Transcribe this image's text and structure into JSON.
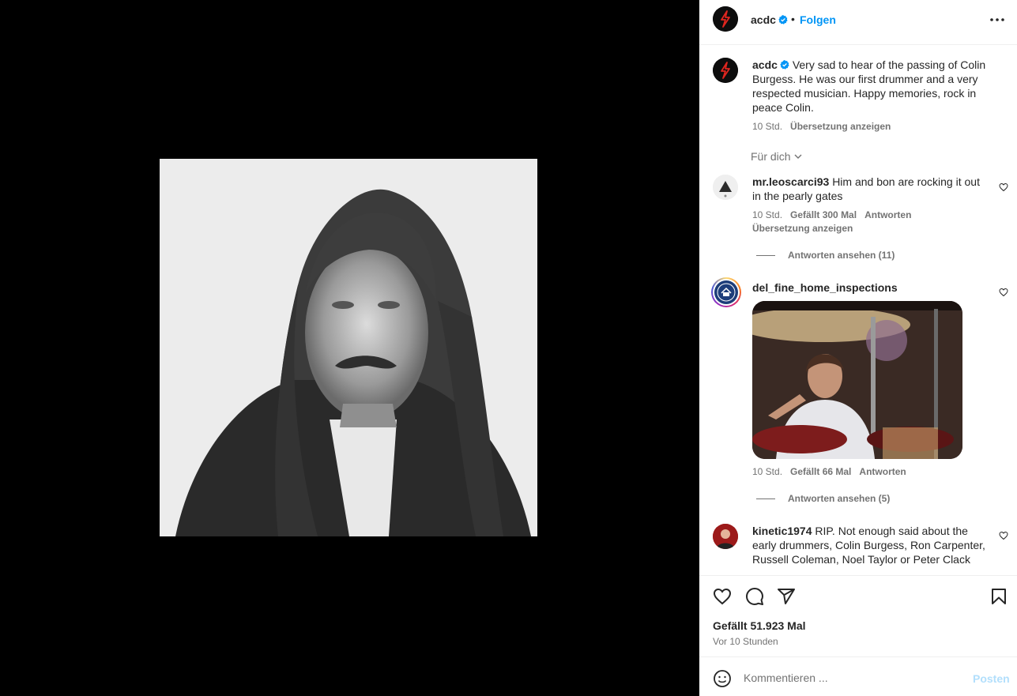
{
  "post": {
    "username": "acdc",
    "follow_label": "Folgen",
    "separator": "•",
    "caption": "Very sad to hear of the passing of Colin Burgess. He was our first drummer and a very respected musician. Happy memories, rock in peace Colin.",
    "caption_time": "10 Std.",
    "translate_label": "Übersetzung anzeigen",
    "image_icon": "portrait-photo"
  },
  "comments_filter": "Für dich",
  "comments": [
    {
      "username": "mr.leoscarci93",
      "text": "Him and bon are rocking it out in the pearly gates",
      "time": "10 Std.",
      "likes": "Gefällt 300 Mal",
      "reply": "Antworten",
      "translate": "Übersetzung anzeigen",
      "view_replies": "Antworten ansehen (11)"
    },
    {
      "username": "del_fine_home_inspections",
      "text": "",
      "time": "10 Std.",
      "likes": "Gefällt 66 Mal",
      "reply": "Antworten",
      "view_replies": "Antworten ansehen (5)"
    },
    {
      "username": "kinetic1974",
      "text": "RIP. Not enough said about the early drummers, Colin Burgess, Ron Carpenter, Russell Coleman, Noel Taylor or Peter Clack"
    }
  ],
  "actions": {
    "likes": "Gefällt 51.923 Mal",
    "posted": "Vor 10 Stunden"
  },
  "comment_box": {
    "placeholder": "Kommentieren ...",
    "post_label": "Posten"
  },
  "colors": {
    "accent": "#0095f6",
    "muted": "#737373",
    "post_disabled": "#b2dffc"
  }
}
